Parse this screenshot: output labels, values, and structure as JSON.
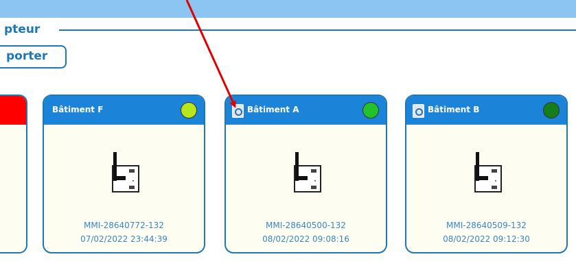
{
  "header": {
    "legend": "pteur",
    "export_label": "porter"
  },
  "cards": [
    {
      "title": "Bâtiment F",
      "id": "MMI-28640772-132",
      "date": "07/02/2022 23:44:39",
      "status_color": "#b6e61b",
      "has_doc_icon": false
    },
    {
      "title": "Bâtiment A",
      "id": "MMI-28640500-132",
      "date": "08/02/2022 09:08:16",
      "status_color": "#22c22b",
      "has_doc_icon": true
    },
    {
      "title": "Bâtiment B",
      "id": "MMI-28640509-132",
      "date": "08/02/2022 09:12:30",
      "status_color": "#137e1a",
      "has_doc_icon": true
    }
  ],
  "partial_card": {
    "status_color": "#ff0000"
  },
  "colors": {
    "accent": "#1b78b2",
    "card_header": "#1b84d9",
    "top_bar": "#8cc4f2",
    "annotation": "#e00000"
  },
  "icons": {
    "device": "sensor-device-icon",
    "document": "document-search-icon",
    "annotation": "annotation-arrow-icon"
  }
}
